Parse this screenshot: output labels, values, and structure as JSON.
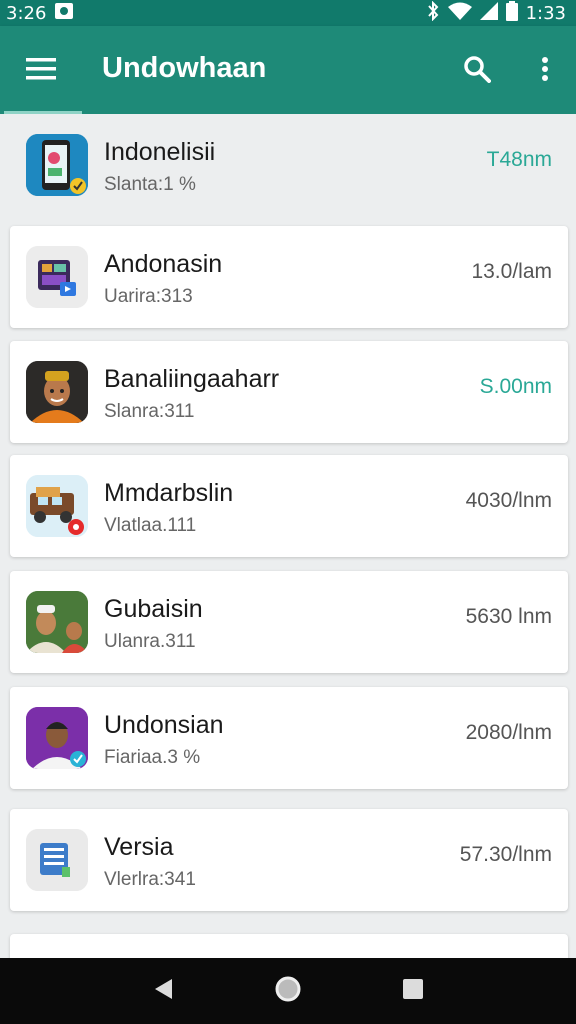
{
  "status_bar": {
    "time_left": "3:26",
    "time_right": "1:33"
  },
  "app_bar": {
    "title": "Undowhaan",
    "icons": [
      "menu-icon",
      "search-icon",
      "more-vert-icon"
    ]
  },
  "colors": {
    "app_bar": "#1e8a78",
    "status_bar": "#117a6b",
    "accent_teal": "#2aa896",
    "value_gray": "#555555"
  },
  "items": [
    {
      "name": "Indonelisii",
      "sub": "Slanta:1 %",
      "value": "T48nm",
      "value_color": "#2aa896",
      "icon": "app-phone-icon"
    },
    {
      "name": "Andonasin",
      "sub": "Uarira:313",
      "value": "13.0/lam",
      "value_color": "#555555",
      "icon": "app-grid-icon"
    },
    {
      "name": "Banaliingaaharr",
      "sub": "Slanra:311",
      "value": "S.00nm",
      "value_color": "#2aa896",
      "icon": "avatar-man-icon"
    },
    {
      "name": "Mmdarbslin",
      "sub": "Vlatlaa.111",
      "value": "4030/lnm",
      "value_color": "#555555",
      "icon": "app-vehicle-icon"
    },
    {
      "name": "Gubaisin",
      "sub": "Ulanra.311",
      "value": "5630 lnm",
      "value_color": "#555555",
      "icon": "avatar-group-icon"
    },
    {
      "name": "Undonsian",
      "sub": "Fiariaa.3 %",
      "value": "2080/lnm",
      "value_color": "#555555",
      "icon": "avatar-verified-icon"
    },
    {
      "name": "Versia",
      "sub": "Vlerlra:341",
      "value": "57.30/lnm",
      "value_color": "#555555",
      "icon": "app-list-icon"
    }
  ]
}
